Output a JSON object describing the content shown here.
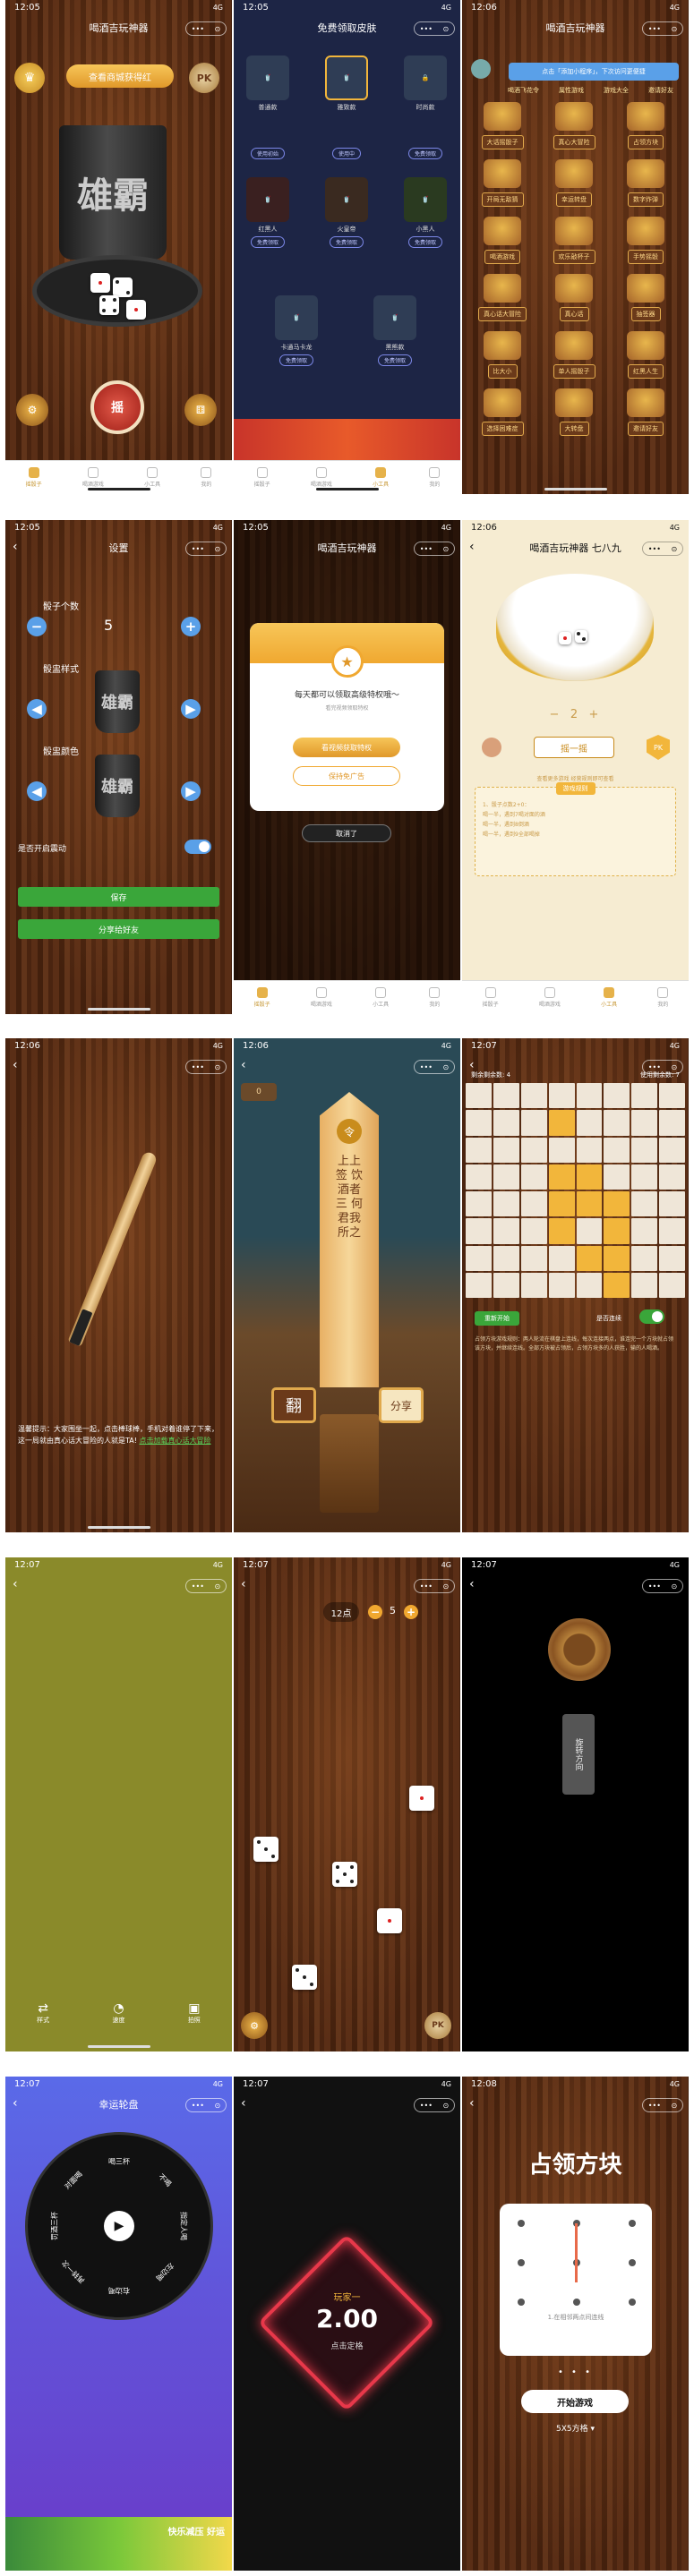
{
  "status": {
    "times": [
      "12:05",
      "12:05",
      "12:06",
      "12:05",
      "12:05",
      "12:06",
      "12:06",
      "12:06",
      "12:07",
      "12:07",
      "12:07",
      "12:07",
      "12:07",
      "12:07",
      "12:08"
    ],
    "signal": "4G"
  },
  "app_title": "喝酒吉玩神器",
  "capsule": {
    "dots": "•••",
    "target": "⊙"
  },
  "tabs": [
    "摇骰子",
    "喝酒游戏",
    "小工具",
    "我的"
  ],
  "s1": {
    "top_button": "查看商城获得红",
    "pk": "PK",
    "cup_text": "雄霸",
    "shake_label": "摇"
  },
  "s2": {
    "title": "免费领取皮肤",
    "skins": [
      {
        "name": "普通款",
        "tag": "",
        "action": "使用初始"
      },
      {
        "name": "雅致款",
        "tag": "选中",
        "action": "使用中"
      },
      {
        "name": "时尚款",
        "tag": "",
        "action": "免费领取"
      },
      {
        "name": "红黑人",
        "tag": "",
        "action": "免费领取"
      },
      {
        "name": "火皇帝",
        "tag": "",
        "action": "免费领取"
      },
      {
        "name": "小黑人",
        "tag": "",
        "action": "免费领取"
      },
      {
        "name": "卡通马卡龙",
        "tag": "",
        "action": "免费领取"
      },
      {
        "name": "黑熊款",
        "tag": "",
        "action": "免费领取"
      }
    ]
  },
  "s3": {
    "tooltip": "点击「添加小程序」，下次访问更便捷",
    "header_tabs": [
      "喝酒飞花令",
      "属性游戏",
      "游戏大全",
      "邀请好友"
    ],
    "games": [
      "大话摇骰子",
      "真心大冒险",
      "占领方块",
      "开局无敌猜",
      "幸运转盘",
      "数字炸弹",
      "喝酒游戏",
      "欢乐敲杯子",
      "手势摇骰",
      "真心话大冒险",
      "真心话",
      "抽签器",
      "比大小",
      "单人摇骰子",
      "红黑人生",
      "选择困难症",
      "大转盘",
      "邀请好友"
    ]
  },
  "s4": {
    "title": "设置",
    "dice_count_label": "骰子个数",
    "dice_count": "5",
    "style_label": "骰盅样式",
    "color_label": "骰盅颜色",
    "cup_text": "雄霸",
    "vibrate_label": "是否开启震动",
    "save": "保存",
    "share": "分享给好友"
  },
  "s5": {
    "dialog_title": "每天都可以领取高级特权哦～",
    "dialog_sub": "看完视频领取特权",
    "btn_primary": "看视频获取特权",
    "btn_secondary": "保持免广告",
    "under_button": "取消了"
  },
  "s6": {
    "title": "喝酒吉玩神器 七八九",
    "value": "2",
    "shake": "摇一摇",
    "link": "查看更多游戏 经营规则即可查看",
    "rules_title": "游戏规则",
    "rules": [
      "1、骰子点数2+0：",
      "喝一半，遇到7喝对面的酒",
      "喝一半，遇到8倒酒",
      "喝一半，遇到9全部喝掉"
    ]
  },
  "s7": {
    "tip": "温馨提示：大家围坐一起，点击棒球棒，手机对着谁停了下来，这一局就由真心话大冒险的人就是TA!",
    "link": "点击加载真心话大冒险"
  },
  "s8": {
    "badge": "0",
    "seal": "令",
    "sign_text": "上上签 饮酒者三 何君我所之",
    "flip": "翻",
    "share": "分享"
  },
  "s9": {
    "label_left": "剩余剩余数: 4",
    "label_right": "使用剩余数: 7",
    "start": "重新开始",
    "toggle": "是否连续",
    "tip": "占领方块游戏规则：两人轮流在棋盘上连线，每次连接两点，谁连完一个方块就占领该方块，并继续连线。全部方块被占领后，占领方块多的人获胜，输的人喝酒。"
  },
  "s10": {
    "tools": [
      "样式",
      "速度",
      "拍照"
    ]
  },
  "s11": {
    "points": "12点",
    "count": "5",
    "pk": "PK"
  },
  "s12": {
    "spin": "旋转方向"
  },
  "s13": {
    "title": "幸运轮盘",
    "segments": [
      "喝三杯",
      "不喝",
      "指定人喝",
      "左边喝",
      "右边喝",
      "再转一次",
      "罚酒三杯",
      "对面喝"
    ],
    "banner_text": "快乐减压 好运"
  },
  "s14": {
    "label": "玩家一",
    "value": "2.00",
    "sub": "点击定格"
  },
  "s15": {
    "title": "占领方块",
    "hint": "1.在相邻两点间连线",
    "start": "开始游戏",
    "size": "5X5方格"
  },
  "colors": {
    "gold": "#f2b63b",
    "green": "#3aa63a",
    "blue": "#5aa0e8",
    "red": "#c8342a"
  }
}
